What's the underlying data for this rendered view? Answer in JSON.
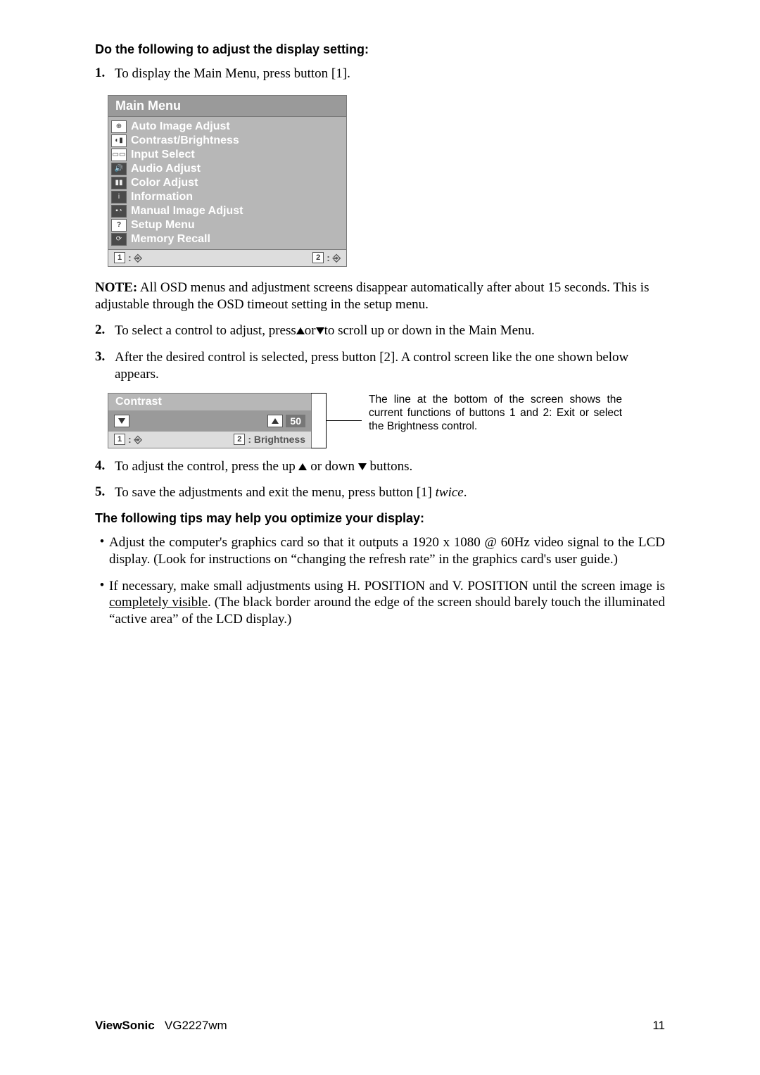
{
  "heading1": "Do the following to adjust the display setting:",
  "step1_num": "1.",
  "step1_text": "To display the Main Menu, press button [1].",
  "osd_title": "Main Menu",
  "osd_items": [
    "Auto Image Adjust",
    "Contrast/Brightness",
    "Input Select",
    "Audio Adjust",
    "Color Adjust",
    "Information",
    "Manual Image Adjust",
    "Setup Menu",
    "Memory Recall"
  ],
  "osd_keys": {
    "k1": "1",
    "k2": "2"
  },
  "note_label": "NOTE:",
  "note_text": " All OSD menus and adjustment screens disappear automatically after about 15 seconds. This is adjustable through the OSD timeout setting in the setup menu.",
  "step2_num": "2.",
  "step2_pre": "To select a control to adjust, press",
  "step2_mid": "or",
  "step2_post": "to scroll up or down in the Main Menu.",
  "step3_num": "3.",
  "step3_text": "After the desired control is selected, press button [2]. A control screen like the one shown below appears.",
  "contrast_title": "Contrast",
  "contrast_value": "50",
  "contrast_footer_k1": "1",
  "contrast_footer_right_key": "2",
  "contrast_footer_right_label": ": Brightness",
  "side_note": "The line at the bottom of the screen shows the current functions of buttons 1 and 2: Exit or select the Brightness control.",
  "step4_num": "4.",
  "step4_pre": "To adjust the control, press the up ",
  "step4_mid": " or down ",
  "step4_post": " buttons.",
  "step5_num": "5.",
  "step5_pre": "To save the adjustments and exit the menu, press button [1] ",
  "step5_italic": "twice",
  "step5_post": ".",
  "heading2": "The following tips may help you optimize your display:",
  "bullet1": "Adjust the computer's graphics card so that it outputs a 1920 x 1080 @ 60Hz video signal to the LCD display. (Look for instructions on “changing the refresh rate” in the graphics card's user guide.)",
  "bullet2_pre": "If necessary, make small adjustments using H. POSITION and V. POSITION until the screen image is ",
  "bullet2_underline": "completely visible",
  "bullet2_post": ". (The black border around the edge of the screen should barely touch the illuminated “active area” of the LCD display.)",
  "footer_brand": "ViewSonic",
  "footer_model": "VG2227wm",
  "footer_page": "11"
}
